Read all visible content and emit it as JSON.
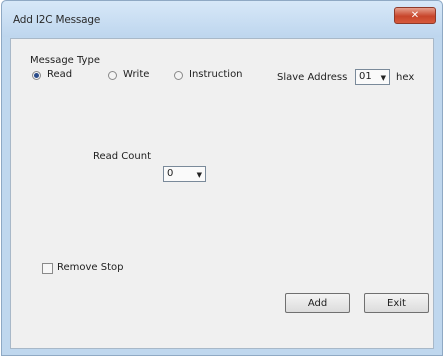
{
  "window": {
    "title": "Add I2C Message",
    "close_glyph": "✕"
  },
  "message_type": {
    "label": "Message Type",
    "options": [
      {
        "label": "Read",
        "selected": true
      },
      {
        "label": "Write",
        "selected": false
      },
      {
        "label": "Instruction",
        "selected": false
      }
    ]
  },
  "slave_address": {
    "label": "Slave Address",
    "value": "01",
    "unit": "hex"
  },
  "read_count": {
    "label": "Read Count",
    "value": "0"
  },
  "remove_stop": {
    "label": "Remove Stop",
    "checked": false
  },
  "buttons": {
    "add": "Add",
    "exit": "Exit"
  }
}
